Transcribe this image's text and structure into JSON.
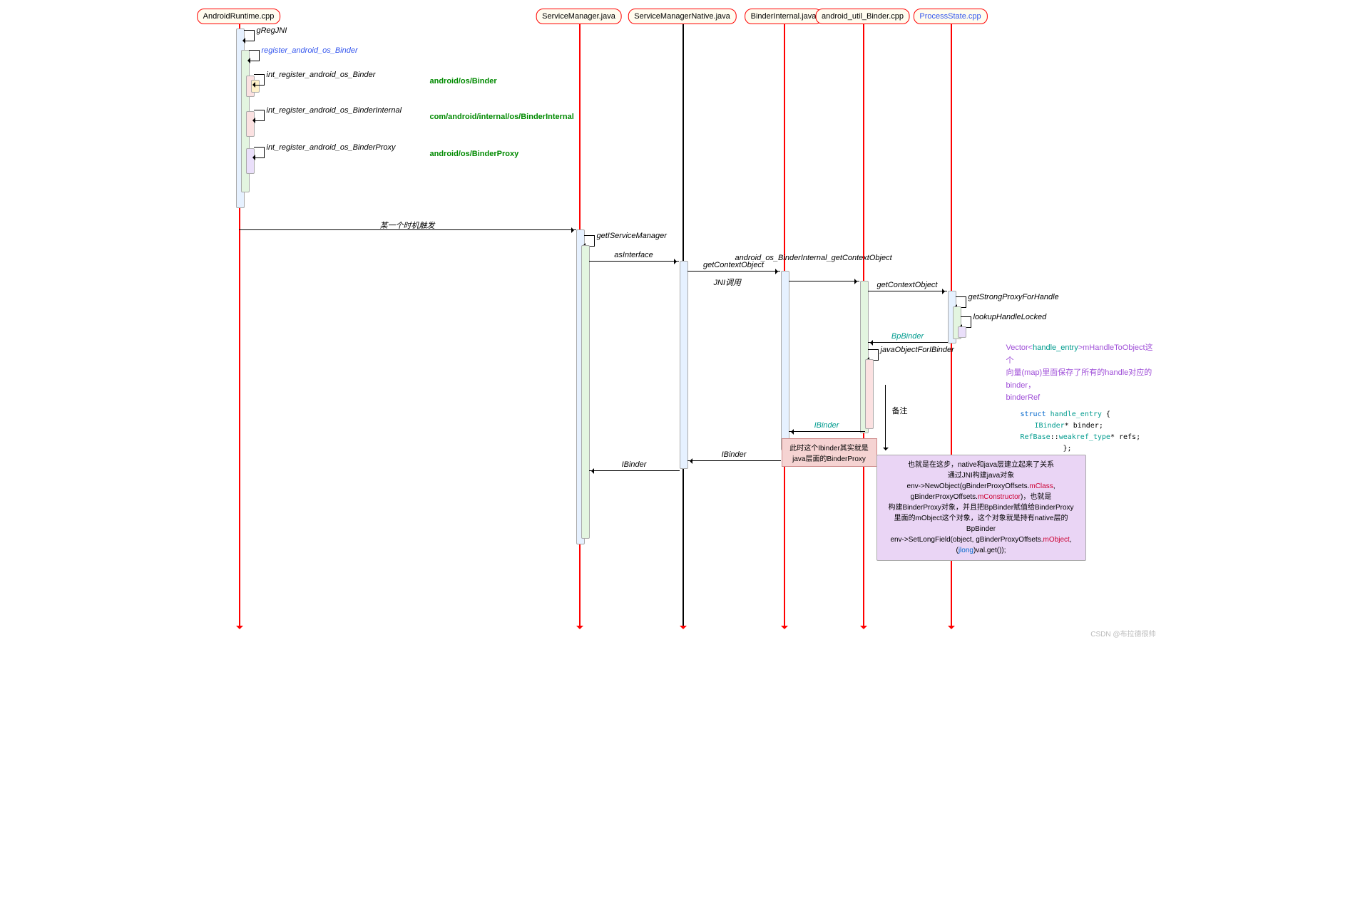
{
  "heads": {
    "h1": "AndroidRuntime.cpp",
    "h2": "ServiceManager.java",
    "h3": "ServiceManagerNative.java",
    "h4": "BinderInternal.java",
    "h5": "android_util_Binder.cpp",
    "h6": "ProcessState.cpp"
  },
  "calls": {
    "gregjni": "gRegJNI",
    "reg": "register_android_os_Binder",
    "int1": "int_register_android_os_Binder",
    "int2": "int_register_android_os_BinderInternal",
    "int3": "int_register_android_os_BinderProxy",
    "trig": "某一个时机触发",
    "getSM": "getIServiceManager",
    "asIf": "asInterface",
    "getCtx": "getContextObject",
    "jni": "JNI调用",
    "long": "android_os_BinderInternal_getContextObject",
    "strong": "getStrongProxyForHandle",
    "lookup": "lookupHandleLocked",
    "bp": "BpBinder",
    "jofb": "javaObjectForIBinder",
    "remark": "备注",
    "ib": "IBinder",
    "ib2": "IBinder"
  },
  "ann": {
    "a1": "android/os/Binder",
    "a2": "com/android/internal/os/BinderInternal",
    "a3": "android/os/BinderProxy"
  },
  "notes": {
    "pink": "此时这个Ibinder其实就是\njava层面的BinderProxy",
    "top": "也就是在这步，native和java层建立起来了关系",
    "l1": "通过JNI构建java对象",
    "l2a": "env->NewObject(gBinderProxyOffsets.",
    "l2b": "mClass",
    "l2c": ",",
    "l3a": "gBinderProxyOffsets.",
    "l3b": "mConstructor",
    "l3c": ")，也就是",
    "l4": "构建BinderProxy对象，并且把BpBinder赋值给BinderProxy",
    "l5": "里面的mObject这个对象，这个对象就是持有native层的BpBinder",
    "l6a": "env->SetLongField(object, gBinderProxyOffsets.",
    "l6b": "mObject",
    "l6c": ",",
    "l7a": "(",
    "l7b": "jlong",
    "l7c": ")val.get());"
  },
  "free": {
    "f1a": "Vector<",
    "f1b": "handle_entry",
    "f1c": ">mHandleToObject这个",
    "f2": "向量(map)里面保存了所有的handle对应的binder，",
    "f3": "binderRef",
    "c1a": "struct ",
    "c1b": "handle_entry",
    " c1c": " {",
    "c2a": "IBinder",
    "c2b": "* binder;",
    "c3a": "RefBase",
    "c3b": "::",
    "c3c": "weakref_type",
    "c3d": "* refs;",
    "c4": "};"
  },
  "wm": "CSDN @布拉德很帅"
}
